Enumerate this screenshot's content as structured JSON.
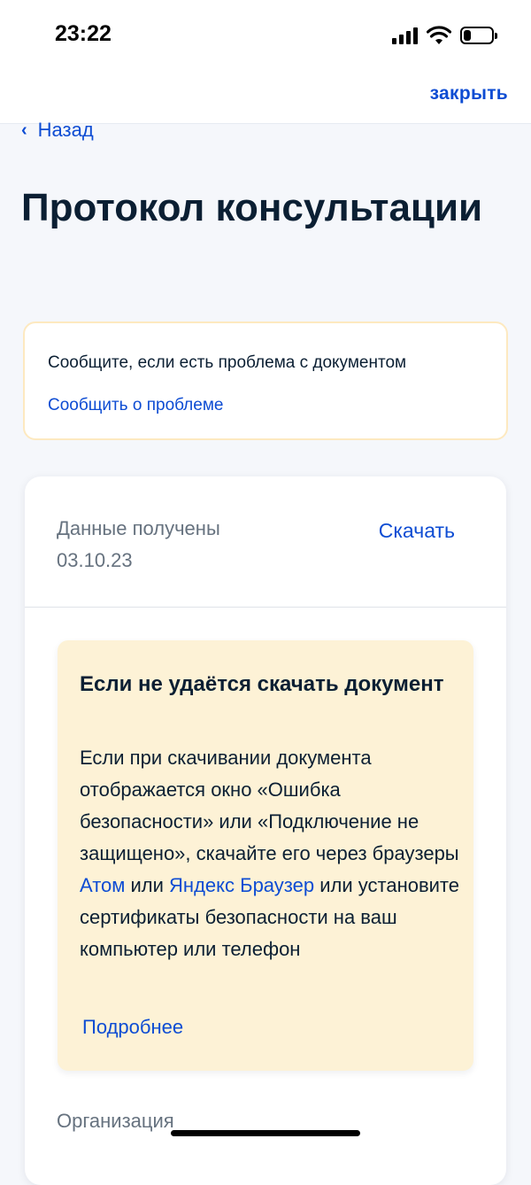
{
  "status_bar": {
    "time": "23:22",
    "battery_level": 0.25,
    "signal_icon": "cellular-signal-icon",
    "wifi_icon": "wifi-icon",
    "battery_icon": "battery-icon"
  },
  "header": {
    "close_label": "закрыть",
    "back_label": "Назад",
    "back_icon": "chevron-left-icon"
  },
  "page": {
    "title": "Протокол консультации"
  },
  "problem_box": {
    "text": "Сообщите, если есть проблема с документом",
    "link": "Сообщить о проблеме"
  },
  "document": {
    "received_label": "Данные получены",
    "received_date": "03.10.23",
    "download_label": "Скачать"
  },
  "warning": {
    "title": "Если не удаётся скачать документ",
    "body_part1": "Если при скачивании документа отображается окно «Ошибка безопасности» или «Подключение не защищено», скачайте его через браузеры ",
    "link_atom": "Атом",
    "body_or": " или ",
    "link_yandex": "Яндекс Браузер",
    "body_part2": " или установите сертификаты безопасности на ваш компьютер или телефон",
    "more_link": "Подробнее"
  },
  "organization": {
    "label": "Организация"
  },
  "colors": {
    "link": "#0d4cd3",
    "text": "#0b1f33",
    "muted": "#66727f",
    "warning_bg": "#fdf2d6",
    "problem_border": "#fde9c0",
    "page_bg": "#f5f7fb"
  }
}
